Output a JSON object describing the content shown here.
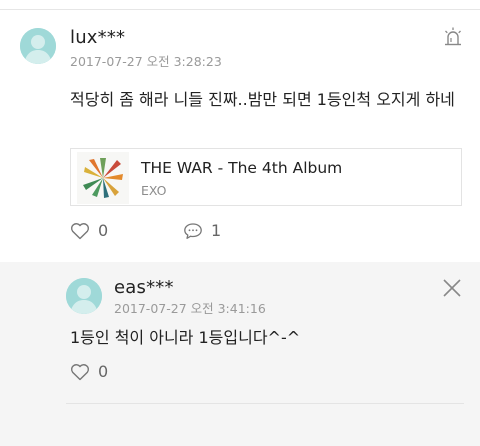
{
  "comment": {
    "username": "lux***",
    "timestamp": "2017-07-27 오전 3:28:23",
    "text": "적당히 좀 해라 니들 진짜..밤만 되면 1등인척 오지게 하네",
    "album": {
      "title": "THE WAR - The 4th Album",
      "artist": "EXO"
    },
    "likes": "0",
    "replies": "1"
  },
  "reply": {
    "username": "eas***",
    "timestamp": "2017-07-27 오전 3:41:16",
    "text": "1등인 척이 아니라 1등입니다^-^",
    "likes": "0"
  },
  "icons": {
    "avatar": "default-user-avatar-icon",
    "report": "siren-report-icon",
    "like": "heart-outline-icon",
    "reply": "speech-bubble-icon",
    "close": "close-x-icon"
  },
  "colors": {
    "avatar_bg": "#9fd9d8",
    "reply_bg": "#f5f5f5",
    "muted_text": "#9a9a9a"
  }
}
